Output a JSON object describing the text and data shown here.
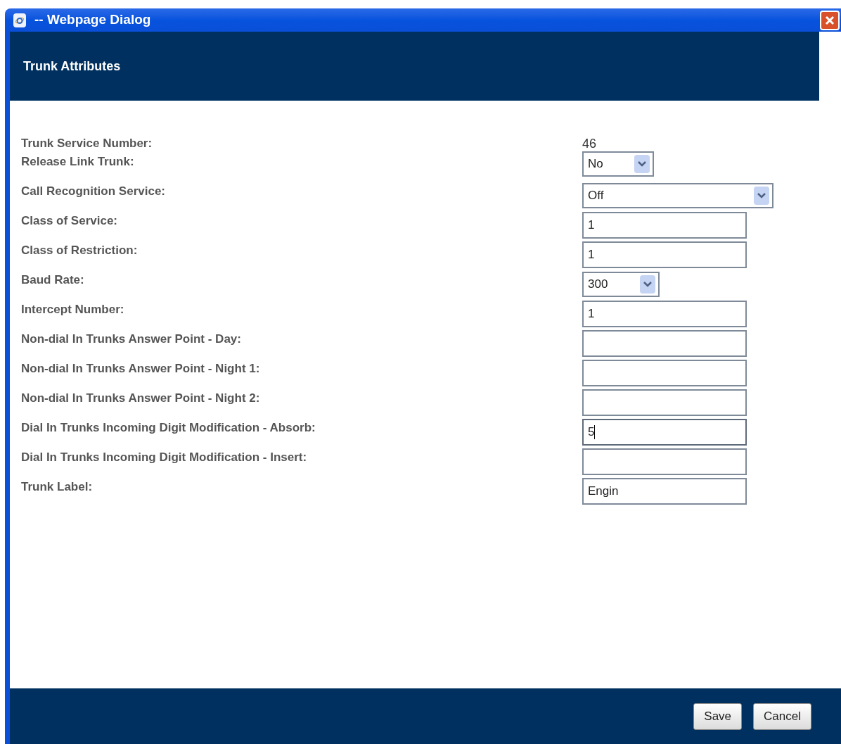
{
  "window": {
    "title": "-- Webpage Dialog"
  },
  "header": {
    "title": "Trunk Attributes"
  },
  "fields": [
    {
      "label": "Trunk Service Number:",
      "kind": "text",
      "value": "46"
    },
    {
      "label": "Release Link Trunk:",
      "kind": "select",
      "value": "No"
    },
    {
      "label": "Call Recognition Service:",
      "kind": "wide-select",
      "value": "Off"
    },
    {
      "label": "Class of Service:",
      "kind": "input",
      "value": "1",
      "focused": false
    },
    {
      "label": "Class of Restriction:",
      "kind": "input",
      "value": "1",
      "focused": false
    },
    {
      "label": "Baud Rate:",
      "kind": "select",
      "value": "300"
    },
    {
      "label": "Intercept Number:",
      "kind": "input",
      "value": "1",
      "focused": false
    },
    {
      "label": "Non-dial In Trunks Answer Point - Day:",
      "kind": "input",
      "focused": false
    },
    {
      "label": "Non-dial In Trunks Answer Point - Night 1:",
      "kind": "input",
      "focused": false
    },
    {
      "label": "Non-dial In Trunks Answer Point - Night 2:",
      "kind": "input",
      "focused": false
    },
    {
      "label": "Dial In Trunks Incoming Digit Modification - Absorb:",
      "kind": "input",
      "value": "5",
      "focused": true
    },
    {
      "label": "Dial In Trunks Incoming Digit Modification - Insert:",
      "kind": "input",
      "focused": false
    },
    {
      "label": "Trunk Label:",
      "kind": "input",
      "value": "Engin",
      "focused": false
    }
  ],
  "buttons": [
    "Save",
    "Cancel"
  ]
}
